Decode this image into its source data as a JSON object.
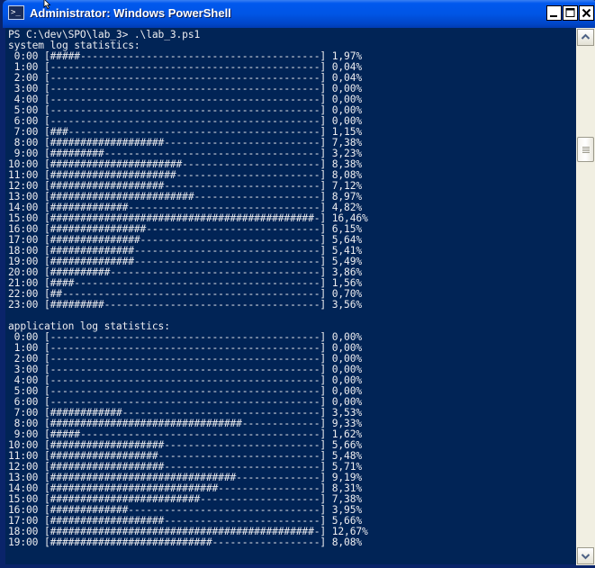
{
  "window": {
    "title": "Administrator: Windows PowerShell",
    "app_icon_glyph": ">_",
    "icons": {
      "app": "powershell-icon",
      "minimize": "minimize-icon",
      "maximize": "maximize-icon",
      "close": "close-icon",
      "cursor": "mouse-pointer-icon"
    }
  },
  "console": {
    "prompt": "PS C:\\dev\\SPO\\lab_3> .\\lab_3.ps1",
    "bar_width": 45,
    "sections": [
      {
        "header": "system log statistics:",
        "rows": [
          {
            "hour": "0:00",
            "filled": 5,
            "percent": "1,97%"
          },
          {
            "hour": "1:00",
            "filled": 0,
            "percent": "0,04%"
          },
          {
            "hour": "2:00",
            "filled": 0,
            "percent": "0,04%"
          },
          {
            "hour": "3:00",
            "filled": 0,
            "percent": "0,00%"
          },
          {
            "hour": "4:00",
            "filled": 0,
            "percent": "0,00%"
          },
          {
            "hour": "5:00",
            "filled": 0,
            "percent": "0,00%"
          },
          {
            "hour": "6:00",
            "filled": 0,
            "percent": "0,00%"
          },
          {
            "hour": "7:00",
            "filled": 3,
            "percent": "1,15%"
          },
          {
            "hour": "8:00",
            "filled": 19,
            "percent": "7,38%"
          },
          {
            "hour": "9:00",
            "filled": 9,
            "percent": "3,23%"
          },
          {
            "hour": "10:00",
            "filled": 22,
            "percent": "8,38%"
          },
          {
            "hour": "11:00",
            "filled": 21,
            "percent": "8,08%"
          },
          {
            "hour": "12:00",
            "filled": 19,
            "percent": "7,12%"
          },
          {
            "hour": "13:00",
            "filled": 24,
            "percent": "8,97%"
          },
          {
            "hour": "14:00",
            "filled": 13,
            "percent": "4,82%"
          },
          {
            "hour": "15:00",
            "filled": 44,
            "percent": "16,46%"
          },
          {
            "hour": "16:00",
            "filled": 16,
            "percent": "6,15%"
          },
          {
            "hour": "17:00",
            "filled": 15,
            "percent": "5,64%"
          },
          {
            "hour": "18:00",
            "filled": 14,
            "percent": "5,41%"
          },
          {
            "hour": "19:00",
            "filled": 14,
            "percent": "5,49%"
          },
          {
            "hour": "20:00",
            "filled": 10,
            "percent": "3,86%"
          },
          {
            "hour": "21:00",
            "filled": 4,
            "percent": "1,56%"
          },
          {
            "hour": "22:00",
            "filled": 2,
            "percent": "0,70%"
          },
          {
            "hour": "23:00",
            "filled": 9,
            "percent": "3,56%"
          }
        ]
      },
      {
        "header": "application log statistics:",
        "rows": [
          {
            "hour": "0:00",
            "filled": 0,
            "percent": "0,00%"
          },
          {
            "hour": "1:00",
            "filled": 0,
            "percent": "0,00%"
          },
          {
            "hour": "2:00",
            "filled": 0,
            "percent": "0,00%"
          },
          {
            "hour": "3:00",
            "filled": 0,
            "percent": "0,00%"
          },
          {
            "hour": "4:00",
            "filled": 0,
            "percent": "0,00%"
          },
          {
            "hour": "5:00",
            "filled": 0,
            "percent": "0,00%"
          },
          {
            "hour": "6:00",
            "filled": 0,
            "percent": "0,00%"
          },
          {
            "hour": "7:00",
            "filled": 12,
            "percent": "3,53%"
          },
          {
            "hour": "8:00",
            "filled": 32,
            "percent": "9,33%"
          },
          {
            "hour": "9:00",
            "filled": 5,
            "percent": "1,62%"
          },
          {
            "hour": "10:00",
            "filled": 19,
            "percent": "5,66%"
          },
          {
            "hour": "11:00",
            "filled": 18,
            "percent": "5,48%"
          },
          {
            "hour": "12:00",
            "filled": 19,
            "percent": "5,71%"
          },
          {
            "hour": "13:00",
            "filled": 31,
            "percent": "9,19%"
          },
          {
            "hour": "14:00",
            "filled": 28,
            "percent": "8,31%"
          },
          {
            "hour": "15:00",
            "filled": 25,
            "percent": "7,38%"
          },
          {
            "hour": "16:00",
            "filled": 13,
            "percent": "3,95%"
          },
          {
            "hour": "17:00",
            "filled": 19,
            "percent": "5,66%"
          },
          {
            "hour": "18:00",
            "filled": 44,
            "percent": "12,67%"
          },
          {
            "hour": "19:00",
            "filled": 27,
            "percent": "8,08%"
          }
        ]
      }
    ]
  },
  "scrollbar": {
    "position_fraction": 0.19,
    "icons": {
      "up": "scroll-up-arrow-icon",
      "down": "scroll-down-arrow-icon",
      "thumb": "scroll-thumb-grip-icon"
    }
  }
}
